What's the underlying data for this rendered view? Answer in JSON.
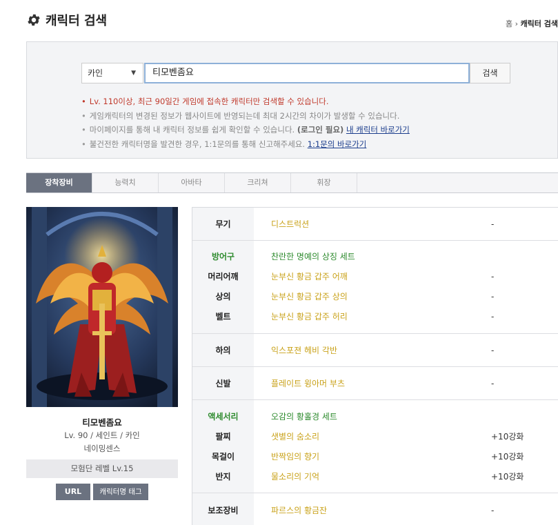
{
  "header": {
    "title": "캐릭터 검색",
    "breadcrumb_home": "홈",
    "breadcrumb_sep": "›",
    "breadcrumb_current": "캐릭터 검색"
  },
  "search": {
    "server": "카인",
    "caret": "▼",
    "query": "티모벤좀요",
    "button": "검색",
    "notes": [
      "Lv. 110이상, 최근 90일간 게임에 접속한 캐릭터만 검색할 수 있습니다.",
      "게임캐릭터의 변경된 정보가 웹사이트에 반영되는데 최대 2시간의 차이가 발생할 수 있습니다.",
      "마이페이지를 통해 내 캐릭터 정보를 쉽게 확인할 수 있습니다. ",
      "불건전한 캐릭터명을 발견한 경우, 1:1문의를 통해 신고해주세요. "
    ],
    "note3_bold": "(로그인 필요)",
    "note3_link": "내 캐릭터 바로가기",
    "note4_link": "1:1문의 바로가기"
  },
  "tabs": [
    "장착장비",
    "능력치",
    "아바타",
    "크리쳐",
    "휘장"
  ],
  "character": {
    "name": "티모벤좀요",
    "info": "Lv. 90 / 세인트 / 카인",
    "guild": "네이밍센스",
    "adventure": "모험단 레벨 Lv.15",
    "url_button": "URL",
    "tag_button": "캐릭터명 태그"
  },
  "equipment": {
    "weapon": {
      "slot": "무기",
      "item": "디스트럭션",
      "enh": "-"
    },
    "armor_set": {
      "slot": "방어구",
      "item": "찬란한 명예의 상징 세트"
    },
    "shoulder": {
      "slot": "머리어깨",
      "item": "눈부신 황금 갑주 어깨",
      "enh": "-"
    },
    "top": {
      "slot": "상의",
      "item": "눈부신 황금 갑주 상의",
      "enh": "-"
    },
    "belt": {
      "slot": "벨트",
      "item": "눈부신 황금 갑주 허리",
      "enh": "-"
    },
    "pants": {
      "slot": "하의",
      "item": "익스포젼 헤비 각반",
      "enh": "-"
    },
    "shoes": {
      "slot": "신발",
      "item": "플레이트 윙아머 부츠",
      "enh": "-"
    },
    "acc_set": {
      "slot": "액세서리",
      "item": "오감의 황홀경 세트"
    },
    "bracelet": {
      "slot": "팔찌",
      "item": "샛별의 숨소리",
      "enh": "+10강화"
    },
    "necklace": {
      "slot": "목걸이",
      "item": "반짝임의 향기",
      "enh": "+10강화"
    },
    "ring": {
      "slot": "반지",
      "item": "물소리의 기억",
      "enh": "+10강화"
    },
    "sub": {
      "slot": "보조장비",
      "item": "파르스의 황금잔",
      "enh": "-"
    }
  },
  "colors": {
    "item_gold": "#c9a21a",
    "set_green": "#2e8b2e",
    "notice_red": "#c0392b",
    "tab_active": "#6b7280"
  }
}
